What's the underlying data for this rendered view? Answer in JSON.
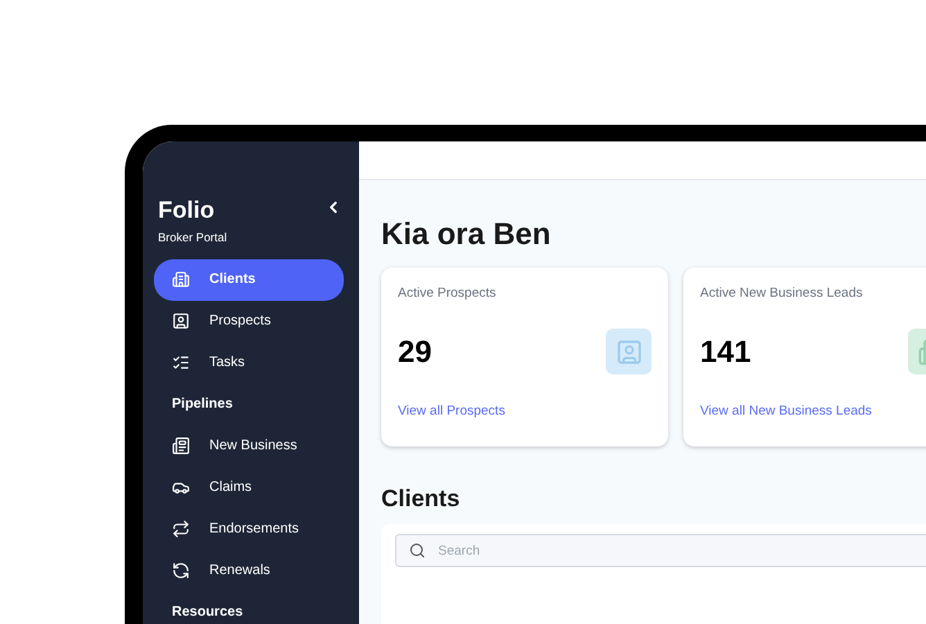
{
  "sidebar": {
    "brand": "Folio",
    "subtitle": "Broker Portal",
    "groups": [
      {
        "items": [
          {
            "label": "Clients",
            "selected": true
          },
          {
            "label": "Prospects",
            "selected": false
          },
          {
            "label": "Tasks",
            "selected": false
          }
        ]
      },
      {
        "heading": "Pipelines",
        "items": [
          {
            "label": "New Business",
            "selected": false
          },
          {
            "label": "Claims",
            "selected": false
          },
          {
            "label": "Endorsements",
            "selected": false
          },
          {
            "label": "Renewals",
            "selected": false
          }
        ]
      },
      {
        "heading": "Resources"
      }
    ]
  },
  "greeting": "Kia ora Ben",
  "cards": [
    {
      "label": "Active Prospects",
      "value": "29",
      "link": "View all Prospects",
      "color": "#d6ebfa"
    },
    {
      "label": "Active New Business Leads",
      "value": "141",
      "link": "View all New Business Leads",
      "color": "#d5efe0"
    }
  ],
  "clients": {
    "title": "Clients",
    "search": {
      "placeholder": "Search"
    }
  }
}
